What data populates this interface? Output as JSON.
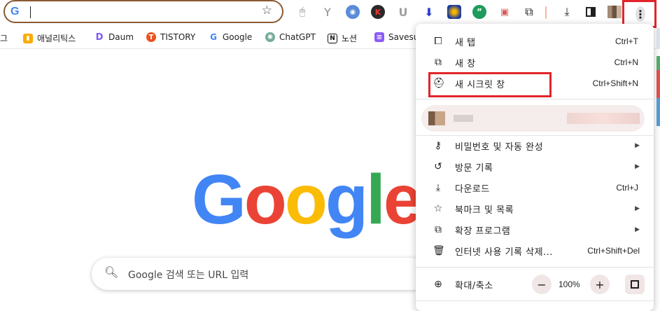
{
  "toolbar": {
    "address_value": "",
    "extensions": [
      "mouse-icon",
      "feather-icon",
      "shield-icon",
      "k-icon",
      "u-icon",
      "arrow-down-icon",
      "colorball-icon",
      "quote-icon",
      "ticket-icon",
      "puzzle-icon"
    ],
    "download_icon": "download-icon",
    "sidepanel_icon": "side-panel-icon",
    "menu_icon": "more-vert-icon"
  },
  "bookmarks": [
    {
      "label": "그",
      "icon": ""
    },
    {
      "label": "애널리틱스",
      "icon": "analytics-icon"
    },
    {
      "label": "Daum",
      "icon": "daum-icon"
    },
    {
      "label": "TISTORY",
      "icon": "tistory-icon"
    },
    {
      "label": "Google",
      "icon": "google-icon"
    },
    {
      "label": "ChatGPT",
      "icon": "chatgpt-icon"
    },
    {
      "label": "노션",
      "icon": "notion-icon"
    },
    {
      "label": "Savesu",
      "icon": "savesu-icon"
    }
  ],
  "google": {
    "logo": [
      "G",
      "o",
      "o",
      "g",
      "l",
      "e"
    ],
    "search_placeholder": "Google 검색 또는 URL 입력"
  },
  "menu": {
    "new_tab": {
      "label": "새 탭",
      "shortcut": "Ctrl+T"
    },
    "new_window": {
      "label": "새 창",
      "shortcut": "Ctrl+N"
    },
    "incognito": {
      "label": "새 시크릿 창",
      "shortcut": "Ctrl+Shift+N"
    },
    "passwords": {
      "label": "비밀번호 및 자동 완성"
    },
    "history": {
      "label": "방문 기록"
    },
    "downloads": {
      "label": "다운로드",
      "shortcut": "Ctrl+J"
    },
    "bookmarks": {
      "label": "북마크 및 목록"
    },
    "extensions": {
      "label": "확장 프로그램"
    },
    "clear_data": {
      "label": "인터넷 사용 기록 삭제...",
      "shortcut": "Ctrl+Shift+Del"
    },
    "zoom": {
      "label": "확대/축소",
      "value": "100%",
      "minus": "−",
      "plus": "+"
    }
  },
  "colors": {
    "highlight": "#e2242a",
    "google_blue": "#4285f4",
    "google_red": "#ea4335",
    "google_yellow": "#fbbc05",
    "google_green": "#34a853"
  }
}
